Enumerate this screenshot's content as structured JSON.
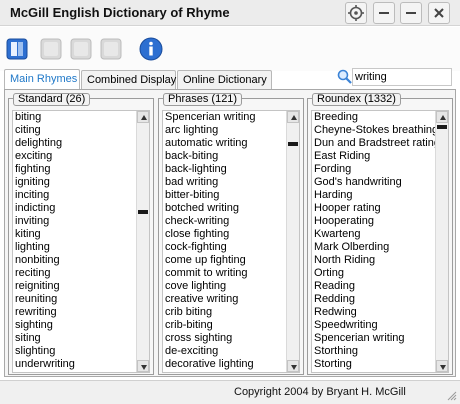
{
  "window": {
    "title": "McGill English Dictionary of Rhyme"
  },
  "toolbar": {
    "icons": [
      "book-icon",
      "blank-icon",
      "blank-icon",
      "blank-icon",
      "info-icon"
    ]
  },
  "tabs": [
    {
      "label": "Main Rhymes",
      "active": true
    },
    {
      "label": "Combined Display",
      "active": false
    },
    {
      "label": "Online Dictionary",
      "active": false
    }
  ],
  "search": {
    "value": "writing",
    "icon": "magnifier-icon"
  },
  "groups": {
    "standard": {
      "label": "Standard (26)",
      "items": [
        "biting",
        "citing",
        "delighting",
        "exciting",
        "fighting",
        "igniting",
        "inciting",
        "indicting",
        "inviting",
        "kiting",
        "lighting",
        "nonbiting",
        "reciting",
        "reigniting",
        "reuniting",
        "rewriting",
        "sighting",
        "siting",
        "slighting",
        "underwriting"
      ]
    },
    "phrases": {
      "label": "Phrases (121)",
      "items": [
        "Spencerian writing",
        "arc lighting",
        "automatic writing",
        "back-biting",
        "back-lighting",
        "bad writing",
        "bitter-biting",
        "botched writing",
        "check-writing",
        "close fighting",
        "cock-fighting",
        "come up fighting",
        "commit to writing",
        "cove lighting",
        "creative writing",
        "crib biting",
        "crib-biting",
        "cross sighting",
        "de-exciting",
        "decorative lighting"
      ]
    },
    "roundex": {
      "label": "Roundex (1332)",
      "items": [
        "Breeding",
        "Cheyne-Stokes breathing",
        "Dun and Bradstreet rating",
        "East Riding",
        "Fording",
        "God's handwriting",
        "Harding",
        "Hooper rating",
        "Hooperating",
        "Kwarteng",
        "Mark Olberding",
        "North Riding",
        "Orting",
        "Reading",
        "Redding",
        "Redwing",
        "Speedwriting",
        "Spencerian writing",
        "Storthing",
        "Storting"
      ]
    }
  },
  "status": {
    "copyright": "Copyright 2004 by Bryant H. McGill"
  },
  "colors": {
    "active_tab_text": "#1f78c8",
    "toolbar_icon_blue": "#2d6fd1"
  }
}
